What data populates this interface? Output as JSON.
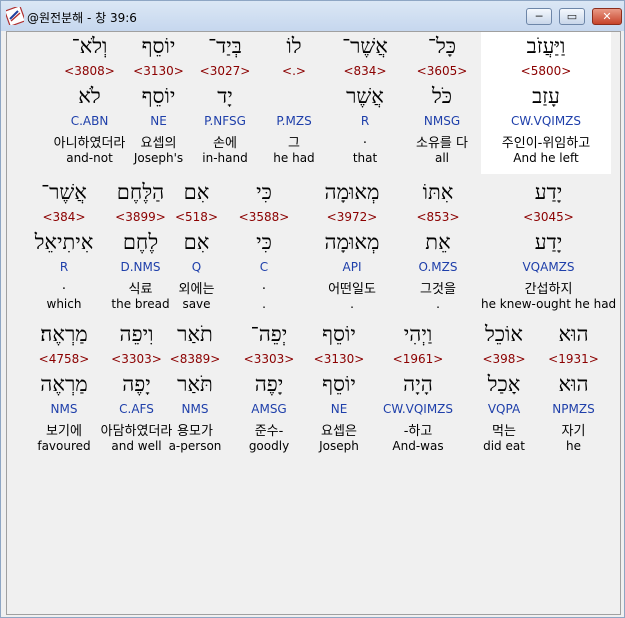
{
  "window": {
    "title": "@원전분해 - 창 39:6",
    "controls": {
      "minimize": "─",
      "maximize": "▭",
      "close": "✕"
    }
  },
  "rows": [
    [
      {
        "heb": "וַיַּעֲזֹב",
        "num": "<5800>",
        "lemma": "עָזַב",
        "parse": "CW.VQIMZS",
        "kor": "주인이-위임하고",
        "eng": "And he left",
        "selected": true
      },
      {
        "heb": "כָּל־",
        "num": "<3605>",
        "lemma": "כֹּל",
        "parse": "NMSG",
        "kor": "소유를 다",
        "eng": "all"
      },
      {
        "heb": "אֲשֶׁר־",
        "num": "<834>",
        "lemma": "אֲשֶׁר",
        "parse": "R",
        "kor": ".",
        "eng": "that"
      },
      {
        "heb": "לוֹ",
        "num": "<.>",
        "lemma": "",
        "parse": "P.MZS",
        "kor": "그",
        "eng": "he had"
      },
      {
        "heb": "בְּיַד־",
        "num": "<3027>",
        "lemma": "יָד",
        "parse": "P.NFSG",
        "kor": "손에",
        "eng": "in-hand"
      },
      {
        "heb": "יוֹסֵף",
        "num": "<3130>",
        "lemma": "יוֹסֵף",
        "parse": "NE",
        "kor": "요셉의",
        "eng": "Joseph's"
      },
      {
        "heb": "וְלֹא־",
        "num": "<3808>",
        "lemma": "לֹא",
        "parse": "C.ABN",
        "kor": "아니하였더라",
        "eng": "and-not"
      }
    ],
    [
      {
        "heb": "יָדַע",
        "num": "<3045>",
        "lemma": "יָדַע",
        "parse": "VQAMZS",
        "kor": "간섭하지",
        "eng": "he knew-ought he had"
      },
      {
        "heb": "אִתּוֹ",
        "num": "<853>",
        "lemma": "אֵת",
        "parse": "O.MZS",
        "kor": "그것을",
        "eng": "."
      },
      {
        "heb": "מְאוּמָה",
        "num": "<3972>",
        "lemma": "מְאוּמָה",
        "parse": "API",
        "kor": "어떤일도",
        "eng": "."
      },
      {
        "heb": "כִּי",
        "num": "<3588>",
        "lemma": "כִּי",
        "parse": "C",
        "kor": ".",
        "eng": "."
      },
      {
        "heb": "אִם",
        "num": "<518>",
        "lemma": "אִם",
        "parse": "Q",
        "kor": "외에는",
        "eng": "save"
      },
      {
        "heb": "הַלֶּחֶם",
        "num": "<3899>",
        "lemma": "לֶחֶם",
        "parse": "D.NMS",
        "kor": "식료",
        "eng": "the bread"
      },
      {
        "heb": "אֲשֶׁר־",
        "num": "<384>",
        "lemma": "אִיתִיאֵל",
        "parse": "R",
        "kor": ".",
        "eng": "which"
      }
    ],
    [
      {
        "heb": "הוּא",
        "num": "<1931>",
        "lemma": "הוּא",
        "parse": "NPMZS",
        "kor": "자기",
        "eng": "he"
      },
      {
        "heb": "אוֹכֵל",
        "num": "<398>",
        "lemma": "אָכַל",
        "parse": "VQPA",
        "kor": "먹는",
        "eng": "did eat"
      },
      {
        "heb": "וַיְהִי",
        "num": "<1961>",
        "lemma": "הָיָה",
        "parse": "CW.VQIMZS",
        "kor": "-하고",
        "eng": "And-was"
      },
      {
        "heb": "יוֹסֵף",
        "num": "<3130>",
        "lemma": "יוֹסֵף",
        "parse": "NE",
        "kor": "요셉은",
        "eng": "Joseph"
      },
      {
        "heb": "יְפֵה־",
        "num": "<3303>",
        "lemma": "יָפֶה",
        "parse": "AMSG",
        "kor": "준수-",
        "eng": "goodly"
      },
      {
        "heb": "תֹאַר",
        "num": "<8389>",
        "lemma": "תֹּאַר",
        "parse": "NMS",
        "kor": "용모가",
        "eng": "a-person"
      },
      {
        "heb": "וִיפֵה",
        "num": "<3303>",
        "lemma": "יָפֶה",
        "parse": "C.AFS",
        "kor": "아담하였더라",
        "eng": "and well"
      },
      {
        "heb": "מַרְאֶה׃",
        "num": "<4758>",
        "lemma": "מַרְאֶה",
        "parse": "NMS",
        "kor": "보기에",
        "eng": "favoured"
      }
    ]
  ]
}
